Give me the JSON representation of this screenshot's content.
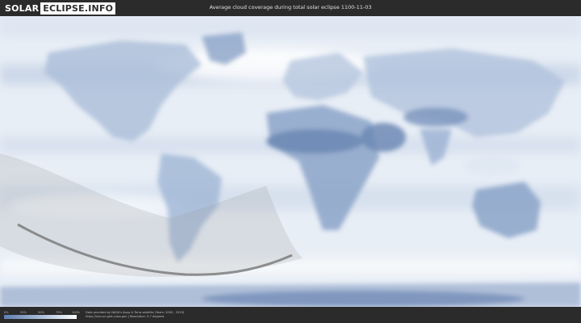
{
  "header": {
    "logo_solar": "SOLAR",
    "logo_eclipse": "ECLIPSE.INFO",
    "title": "Average cloud coverage during total solar eclipse 1100-11-03"
  },
  "legend": {
    "ticks": [
      "0%",
      "25%",
      "50%",
      "75%",
      "100%"
    ],
    "color_low": "#5f7fae",
    "color_high": "#ffffff"
  },
  "footer": {
    "credit_line1": "Data provided by NASA's Aqua & Terra satellite (Years: 2000 - 2019)",
    "credit_line2": "https://neo.sci.gsfc.nasa.gov | Resolution: 0.7 degrees"
  },
  "colors": {
    "background_bar": "#2b2b2b",
    "land_clear": "#6f8ab5",
    "cloud": "#f2f5fa",
    "path_line": "#777777",
    "shadow_overlay": "#888888"
  }
}
